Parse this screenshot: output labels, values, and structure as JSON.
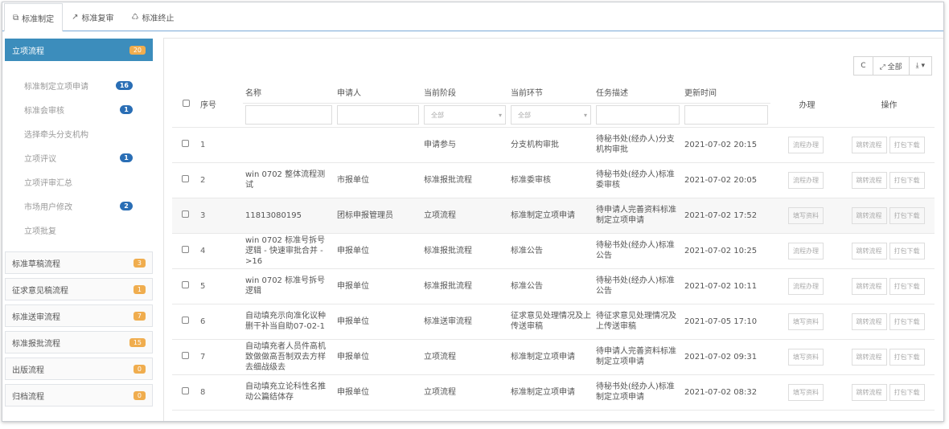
{
  "tabs": [
    {
      "icon": "⧉",
      "label": "标准制定",
      "active": true
    },
    {
      "icon": "↗",
      "label": "标准复审",
      "active": false
    },
    {
      "icon": "♺",
      "label": "标准终止",
      "active": false
    }
  ],
  "sidebar": {
    "groups": [
      {
        "label": "立项流程",
        "count": "20",
        "active": true,
        "items": [
          {
            "label": "标准制定立项申请",
            "count": "16"
          },
          {
            "label": "标准会审核",
            "count": "1"
          },
          {
            "label": "选择牵头分支机构",
            "count": ""
          },
          {
            "label": "立项评议",
            "count": "1"
          },
          {
            "label": "立项评审汇总",
            "count": ""
          },
          {
            "label": "市场用户修改",
            "count": "2"
          },
          {
            "label": "立项批复",
            "count": ""
          }
        ]
      },
      {
        "label": "标准草稿流程",
        "count": "3"
      },
      {
        "label": "征求意见稿流程",
        "count": "1"
      },
      {
        "label": "标准送审流程",
        "count": "7"
      },
      {
        "label": "标准报批流程",
        "count": "15"
      },
      {
        "label": "出版流程",
        "count": "0"
      },
      {
        "label": "归档流程",
        "count": "0"
      }
    ]
  },
  "toolbar": {
    "refresh": "C",
    "fullscreen": "⤢ 全部",
    "export": "⤓ ▾"
  },
  "table": {
    "headers": {
      "seq": "序号",
      "name": "名称",
      "applicant": "申请人",
      "stage": "当前阶段",
      "step": "当前环节",
      "task": "任务描述",
      "updated": "更新时间",
      "handle": "办理",
      "ops": "操作"
    },
    "filter_all": "全部",
    "rows": [
      {
        "seq": "1",
        "name": "",
        "applicant": "",
        "stage": "申请参与",
        "step": "分支机构审批",
        "task": "待秘书处(经办人)分支机构审批",
        "updated": "2021-07-02 20:15",
        "handle": "流程办理",
        "op1": "跳转流程",
        "op2": "打包下载"
      },
      {
        "seq": "2",
        "name": "win 0702 整体流程测试",
        "applicant": "市报单位",
        "stage": "标准报批流程",
        "step": "标准委审核",
        "task": "待秘书处(经办人)标准委审核",
        "updated": "2021-07-02 20:05",
        "handle": "流程办理",
        "op1": "跳转流程",
        "op2": "打包下载"
      },
      {
        "seq": "3",
        "name": "11813080195",
        "applicant": "团标申报管理员",
        "stage": "立项流程",
        "step": "标准制定立项申请",
        "task": "待申请人完善资料标准制定立项申请",
        "updated": "2021-07-02 17:52",
        "handle": "填写资料",
        "op1": "跳转流程",
        "op2": "打包下载"
      },
      {
        "seq": "4",
        "name": "win 0702 标准号拆号逻辑 - 快速审批合并 - >16",
        "applicant": "申报单位",
        "stage": "标准报批流程",
        "step": "标准公告",
        "task": "待秘书处(经办人)标准公告",
        "updated": "2021-07-02 10:25",
        "handle": "流程办理",
        "op1": "跳转流程",
        "op2": "打包下载"
      },
      {
        "seq": "5",
        "name": "win 0702 标准号拆号逻辑",
        "applicant": "申报单位",
        "stage": "标准报批流程",
        "step": "标准公告",
        "task": "待秘书处(经办人)标准公告",
        "updated": "2021-07-02 10:11",
        "handle": "流程办理",
        "op1": "跳转流程",
        "op2": "打包下载"
      },
      {
        "seq": "6",
        "name": "自动填充示向准化议种删干补当自助07-02-1",
        "applicant": "申报单位",
        "stage": "标准送审流程",
        "step": "征求意见处理情况及上传送审稿",
        "task": "待征求意见处理情况及上传送审稿",
        "updated": "2021-07-05 17:10",
        "handle": "填写资料",
        "op1": "跳转流程",
        "op2": "打包下载"
      },
      {
        "seq": "7",
        "name": "自动填充者人员件高机致做做高吾制双去方样去细战级去",
        "applicant": "申报单位",
        "stage": "立项流程",
        "step": "标准制定立项申请",
        "task": "待申请人完善资料标准制定立项申请",
        "updated": "2021-07-02 09:31",
        "handle": "填写资料",
        "op1": "跳转流程",
        "op2": "打包下载"
      },
      {
        "seq": "8",
        "name": "自动填充立论科性名推动公篇结体存",
        "applicant": "申报单位",
        "stage": "立项流程",
        "step": "标准制定立项申请",
        "task": "待秘书处(经办人)标准制定立项申请",
        "updated": "2021-07-02 08:32",
        "handle": "填写资料",
        "op1": "跳转流程",
        "op2": "打包下载"
      }
    ]
  }
}
